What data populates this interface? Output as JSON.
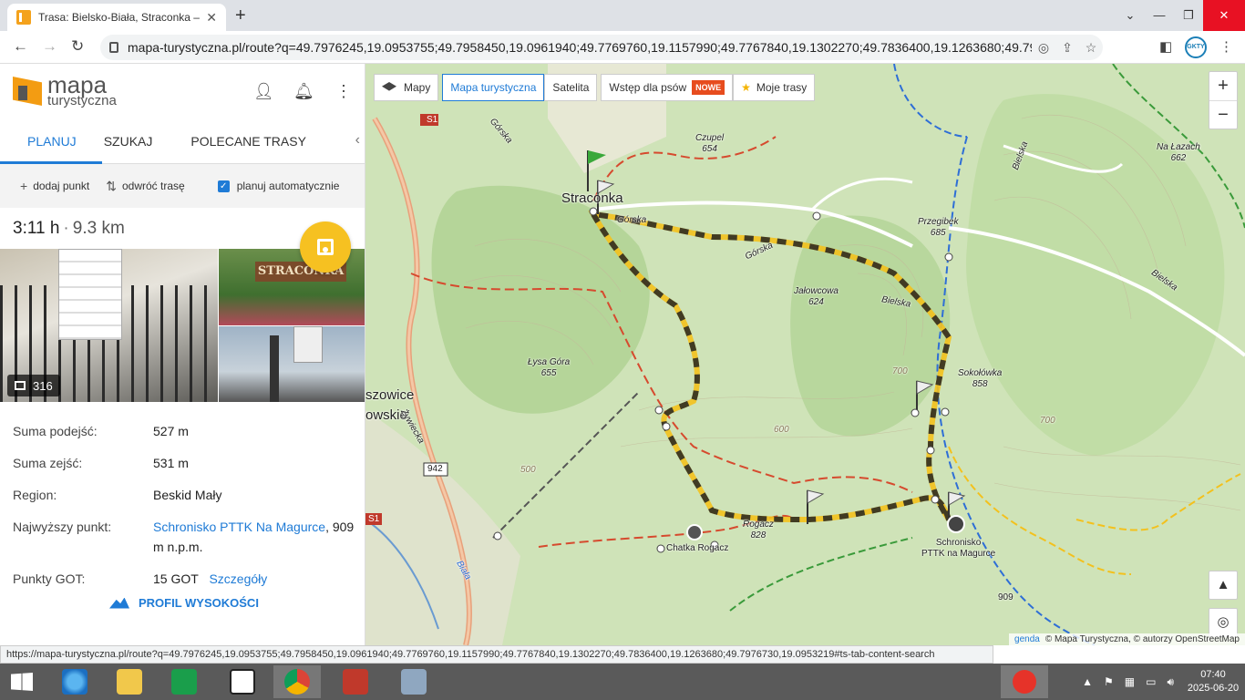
{
  "browser": {
    "tab_title": "Trasa: Bielsko-Biała, Straconka – B",
    "url": "mapa-turystyczna.pl/route?q=49.7976245,19.0953755;49.7958450,19.0961940;49.7769760,19.1157990;49.7767840,19.1302270;49.7836400,19.1263680;49.7976730,..."
  },
  "sidebar": {
    "logo": {
      "line1": "mapa",
      "line2": "turystyczna"
    },
    "tabs": [
      "PLANUJ",
      "SZUKAJ",
      "POLECANE TRASY"
    ],
    "actions": {
      "add": "dodaj punkt",
      "reverse": "odwróć trasę",
      "auto": "planuj automatycznie"
    },
    "time": "3:11 h",
    "distance": "9.3 km",
    "photo_count": "316",
    "photo_board": "STRACONKA",
    "info": {
      "ascent_label": "Suma podejść:",
      "ascent": "527 m",
      "descent_label": "Suma zejść:",
      "descent": "531 m",
      "region_label": "Region:",
      "region": "Beskid Mały",
      "peak_label": "Najwyższy punkt:",
      "peak_link": "Schronisko PTTK Na Magurce",
      "peak_rest": ", 909 m n.p.m.",
      "got_label": "Punkty GOT:",
      "got": "15 GOT",
      "got_link": "Szczegóły"
    },
    "profile": "PROFIL WYSOKOŚCI"
  },
  "map": {
    "buttons": {
      "maps": "Mapy",
      "tourist": "Mapa turystyczna",
      "satellite": "Satelita",
      "dogs": "Wstęp dla psów",
      "new_badge": "NOWE",
      "my_routes": "Moje trasy"
    },
    "labels": {
      "straconka": "Straconka",
      "gorska1": "Górska",
      "gorska2": "Górska",
      "gorska3": "Górska",
      "czupel": "Czupel",
      "czupel_h": "654",
      "przegibek": "Przegibek",
      "przegibek_h": "685",
      "jalowcowa": "Jałowcowa",
      "jalowcowa_h": "624",
      "bielska1": "Bielska",
      "bielska2": "Bielska",
      "bielska3": "Bielska",
      "lysa": "Łysa Góra",
      "lysa_h": "655",
      "sokolowka": "Sokołówka",
      "sokolowka_h": "858",
      "rogacz": "Rogacz",
      "rogacz_h": "828",
      "chatka": "Chatka Rogacz",
      "schronisko1": "Schronisko",
      "schronisko2": "PTTK na Magurce",
      "nalazach": "Na Łazach",
      "nalazach_h": "662",
      "szowice": "szowice",
      "owskie": "owskie",
      "road942": "942",
      "s1a": "S1",
      "s1b": "S1",
      "zywiecka": "Żywiecka",
      "biala": "Biała",
      "h909": "909",
      "h700a": "700",
      "h700b": "700",
      "h600": "600",
      "h500": "500"
    },
    "attribution_legend": "genda",
    "attribution": "© Mapa Turystyczna, © autorzy OpenStreetMap"
  },
  "status_url": "https://mapa-turystyczna.pl/route?q=49.7976245,19.0953755;49.7958450,19.0961940;49.7769760,19.1157990;49.7767840,19.1302270;49.7836400,19.1263680;49.7976730,19.0953219#ts-tab-content-search",
  "clock": {
    "time": "07:40",
    "date": "2025-06-20"
  }
}
